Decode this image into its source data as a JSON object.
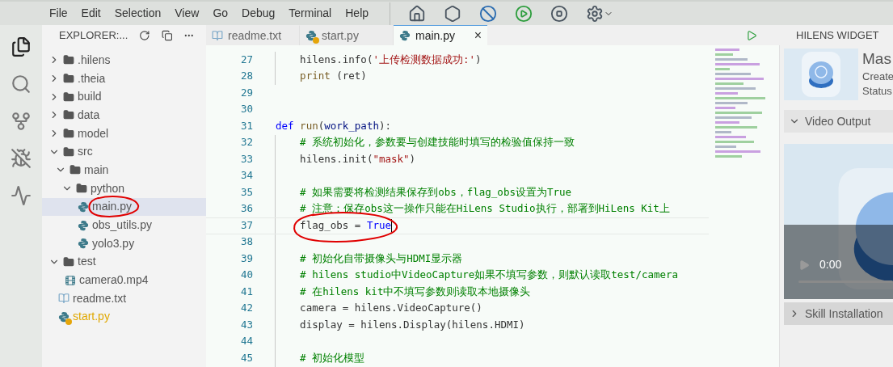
{
  "menu": [
    "File",
    "Edit",
    "Selection",
    "View",
    "Go",
    "Debug",
    "Terminal",
    "Help"
  ],
  "explorer": {
    "title": "EXPLORER:...",
    "tree": [
      {
        "name": ".hilens",
        "kind": "folder",
        "expanded": false,
        "selected": false
      },
      {
        "name": ".theia",
        "kind": "folder",
        "expanded": false,
        "selected": false
      },
      {
        "name": "build",
        "kind": "folder",
        "expanded": false,
        "selected": false
      },
      {
        "name": "data",
        "kind": "folder",
        "expanded": false,
        "selected": false
      },
      {
        "name": "model",
        "kind": "folder",
        "expanded": false,
        "selected": false
      },
      {
        "name": "src",
        "kind": "folder",
        "expanded": true,
        "selected": false,
        "children": [
          {
            "name": "main",
            "kind": "folder",
            "expanded": true,
            "selected": false,
            "children": [
              {
                "name": "python",
                "kind": "folder",
                "expanded": true,
                "selected": false,
                "children": [
                  {
                    "name": "main.py",
                    "kind": "python",
                    "selected": true,
                    "warning": false,
                    "annotated": true
                  },
                  {
                    "name": "obs_utils.py",
                    "kind": "python",
                    "selected": false,
                    "warning": false,
                    "annotated": false
                  },
                  {
                    "name": "yolo3.py",
                    "kind": "python",
                    "selected": false,
                    "warning": false,
                    "annotated": false
                  }
                ]
              }
            ]
          }
        ]
      },
      {
        "name": "test",
        "kind": "folder",
        "expanded": true,
        "selected": false,
        "children": [
          {
            "name": "camera0.mp4",
            "kind": "video",
            "selected": false,
            "warning": false,
            "annotated": false
          }
        ]
      },
      {
        "name": "readme.txt",
        "kind": "text",
        "selected": false,
        "warning": false,
        "annotated": false
      },
      {
        "name": "start.py",
        "kind": "python",
        "selected": false,
        "warning": true,
        "annotated": false
      }
    ]
  },
  "tabs": [
    {
      "label": "readme.txt",
      "kind": "text",
      "selected": false,
      "warning": false
    },
    {
      "label": "start.py",
      "kind": "python",
      "selected": false,
      "warning": true
    },
    {
      "label": "main.py",
      "kind": "python",
      "selected": true,
      "warning": false,
      "close": "×"
    }
  ],
  "editor": {
    "lines": [
      {
        "number": "27",
        "guide": true,
        "current": false,
        "tokens": [
          {
            "kind": "plain",
            "text": "    hilens.info("
          },
          {
            "kind": "string",
            "text": "'上传检测数据成功:'"
          },
          {
            "kind": "plain",
            "text": ")"
          }
        ]
      },
      {
        "number": "28",
        "guide": true,
        "current": false,
        "tokens": [
          {
            "kind": "function",
            "text": "    print"
          },
          {
            "kind": "plain",
            "text": " (ret)"
          }
        ]
      },
      {
        "number": "29",
        "guide": false,
        "current": false
      },
      {
        "number": "30",
        "guide": false,
        "current": false
      },
      {
        "number": "31",
        "guide": false,
        "current": false,
        "tokens": [
          {
            "kind": "keyword",
            "text": "def "
          },
          {
            "kind": "function",
            "text": "run"
          },
          {
            "kind": "plain",
            "text": "("
          },
          {
            "kind": "param",
            "text": "work_path"
          },
          {
            "kind": "plain",
            "text": "):"
          }
        ]
      },
      {
        "number": "32",
        "guide": true,
        "current": false,
        "tokens": [
          {
            "kind": "comment",
            "text": "    # 系统初始化，参数要与创建技能时填写的检验值保持一致"
          }
        ]
      },
      {
        "number": "33",
        "guide": true,
        "current": false,
        "tokens": [
          {
            "kind": "plain",
            "text": "    hilens.init("
          },
          {
            "kind": "string",
            "text": "\"mask\""
          },
          {
            "kind": "plain",
            "text": ")"
          }
        ]
      },
      {
        "number": "34",
        "guide": true,
        "current": false
      },
      {
        "number": "35",
        "guide": true,
        "current": false,
        "tokens": [
          {
            "kind": "comment",
            "text": "    # 如果需要将检测结果保存到obs，flag_obs设置为True"
          }
        ]
      },
      {
        "number": "36",
        "guide": true,
        "current": false,
        "tokens": [
          {
            "kind": "comment",
            "text": "    # 注意：保存obs这一操作只能在HiLens Studio执行，部署到HiLens Kit上"
          }
        ]
      },
      {
        "number": "37",
        "guide": true,
        "current": true,
        "annotated": true,
        "tokens": [
          {
            "kind": "plain",
            "text": "    flag_obs = "
          },
          {
            "kind": "constant",
            "text": "True"
          }
        ]
      },
      {
        "number": "38",
        "guide": true,
        "current": false
      },
      {
        "number": "39",
        "guide": true,
        "current": false,
        "tokens": [
          {
            "kind": "comment",
            "text": "    # 初始化自带摄像头与HDMI显示器"
          }
        ]
      },
      {
        "number": "40",
        "guide": true,
        "current": false,
        "tokens": [
          {
            "kind": "comment",
            "text": "    # hilens studio中VideoCapture如果不填写参数，则默认读取test/camera"
          }
        ]
      },
      {
        "number": "41",
        "guide": true,
        "current": false,
        "tokens": [
          {
            "kind": "comment",
            "text": "    # 在hilens kit中不填写参数则读取本地摄像头"
          }
        ]
      },
      {
        "number": "42",
        "guide": true,
        "current": false,
        "tokens": [
          {
            "kind": "plain",
            "text": "    camera = hilens.VideoCapture()"
          }
        ]
      },
      {
        "number": "43",
        "guide": true,
        "current": false,
        "tokens": [
          {
            "kind": "plain",
            "text": "    display = hilens.Display(hilens.HDMI)"
          }
        ]
      },
      {
        "number": "44",
        "guide": true,
        "current": false
      },
      {
        "number": "45",
        "guide": true,
        "current": false,
        "tokens": [
          {
            "kind": "comment",
            "text": "    # 初始化模型"
          }
        ]
      }
    ]
  },
  "widget": {
    "title": "HILENS WIDGET",
    "skill": {
      "name": "Mas",
      "line_1": "Create",
      "line_2": "Status"
    },
    "sections": [
      {
        "label": "Video Output",
        "expanded": true,
        "time": "0:00"
      },
      {
        "label": "Skill Installation",
        "expanded": false
      }
    ]
  }
}
